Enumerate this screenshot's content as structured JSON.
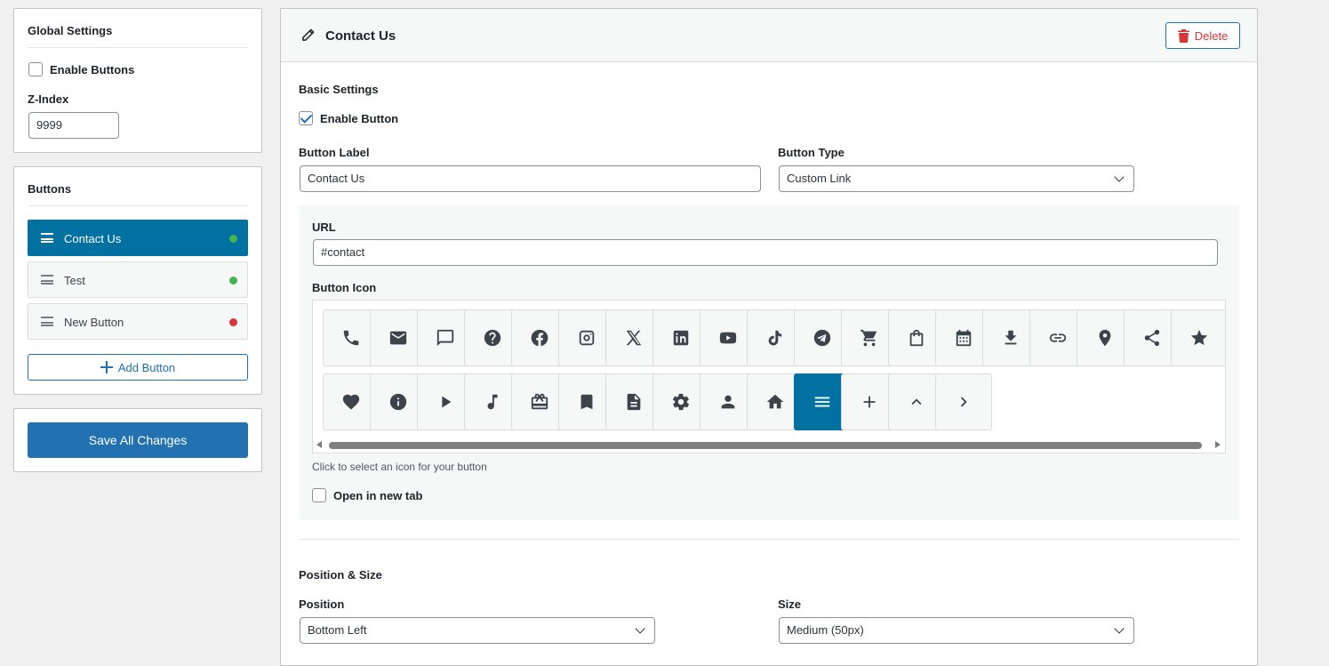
{
  "global_settings": {
    "title": "Global Settings",
    "enable_buttons_label": "Enable Buttons",
    "enable_buttons_checked": false,
    "z_index_label": "Z-Index",
    "z_index_value": "9999"
  },
  "buttons_panel": {
    "title": "Buttons",
    "items": [
      {
        "label": "Contact Us",
        "status_color": "#46b450",
        "active": true
      },
      {
        "label": "Test",
        "status_color": "#46b450",
        "active": false
      },
      {
        "label": "New Button",
        "status_color": "#d63638",
        "active": false
      }
    ],
    "add_button_label": "Add Button"
  },
  "save_all_label": "Save All Changes",
  "editor": {
    "title": "Contact Us",
    "delete_label": "Delete",
    "basic_settings": {
      "heading": "Basic Settings",
      "enable_button_label": "Enable Button",
      "enable_button_checked": true,
      "button_label_label": "Button Label",
      "button_label_value": "Contact Us",
      "button_type_label": "Button Type",
      "button_type_value": "Custom Link",
      "url_label": "URL",
      "url_value": "#contact",
      "button_icon_label": "Button Icon",
      "icon_hint": "Click to select an icon for your button",
      "open_new_tab_label": "Open in new tab",
      "open_new_tab_checked": false
    },
    "icons_row1": [
      "phone-icon",
      "email-icon",
      "chat-icon",
      "help-icon",
      "facebook-icon",
      "instagram-icon",
      "x-icon",
      "linkedin-icon",
      "youtube-icon",
      "tiktok-icon",
      "telegram-icon",
      "cart-icon",
      "shopping-bag-icon",
      "calendar-icon",
      "download-icon",
      "link-icon",
      "location-icon",
      "share-icon",
      "star-icon"
    ],
    "icons_row2": [
      "heart-icon",
      "info-icon",
      "play-icon",
      "music-icon",
      "gift-icon",
      "bookmark-icon",
      "document-icon",
      "gear-icon",
      "person-icon",
      "home-icon",
      "menu-icon",
      "plus-icon",
      "chevron-up-icon",
      "chevron-right-icon"
    ],
    "selected_icon": "menu-icon",
    "position_size": {
      "heading": "Position & Size",
      "position_label": "Position",
      "position_value": "Bottom Left",
      "size_label": "Size",
      "size_value": "Medium (50px)"
    }
  },
  "colors": {
    "accent": "#0071a1",
    "primary_button": "#2271b1",
    "delete": "#d63638"
  }
}
